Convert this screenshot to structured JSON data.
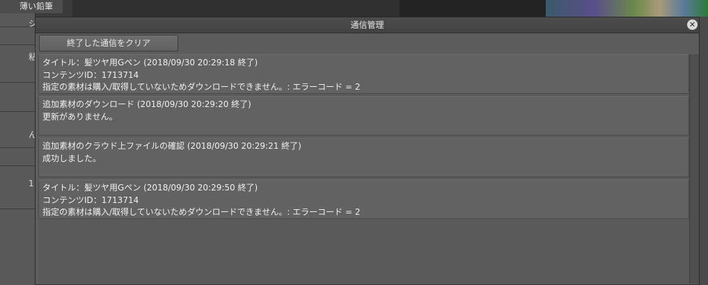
{
  "background": {
    "brush_label": "薄い鉛筆",
    "left_fragments": [
      "シ",
      "粘",
      "ん",
      "1"
    ]
  },
  "dialog": {
    "title": "通信管理",
    "close_symbol": "✕",
    "clear_button": "終了した通信をクリア",
    "entries": [
      {
        "lines": [
          "タイトル：髪ツヤ用Gペン (2018/09/30 20:29:18 終了)",
          "コンテンツID：1713714",
          "指定の素材は購入/取得していないためダウンロードできません。: エラーコード = 2"
        ]
      },
      {
        "lines": [
          "追加素材のダウンロード (2018/09/30 20:29:20 終了)",
          "更新がありません。",
          ""
        ]
      },
      {
        "lines": [
          "追加素材のクラウド上ファイルの確認 (2018/09/30 20:29:21 終了)",
          "成功しました。",
          ""
        ]
      },
      {
        "lines": [
          "タイトル：髪ツヤ用Gペン (2018/09/30 20:29:50 終了)",
          "コンテンツID：1713714",
          "指定の素材は購入/取得していないためダウンロードできません。: エラーコード = 2"
        ]
      }
    ]
  }
}
